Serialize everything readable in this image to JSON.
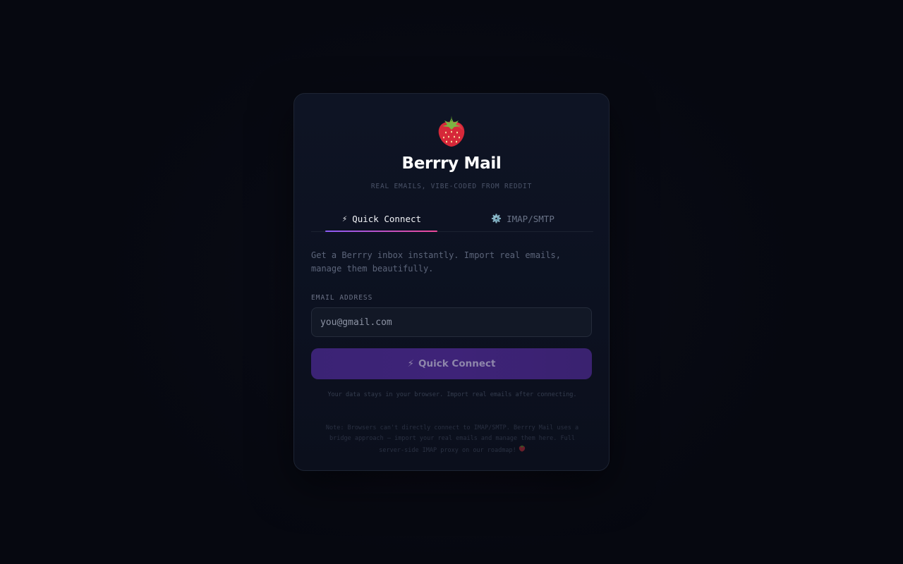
{
  "app": {
    "title": "Berrry Mail",
    "tagline": "REAL EMAILS, VIBE-CODED FROM REDDIT",
    "logo_icon": "strawberry-icon"
  },
  "tabs": [
    {
      "label": "Quick Connect",
      "icon": "lightning-icon",
      "glyph": "⚡",
      "active": true
    },
    {
      "label": "IMAP/SMTP",
      "icon": "gear-icon",
      "glyph": "⚙️",
      "active": false
    }
  ],
  "quick_connect": {
    "description": "Get a Berrry inbox instantly. Import real emails, manage them beautifully.",
    "email_label": "EMAIL ADDRESS",
    "email_value": "",
    "email_placeholder": "you@gmail.com",
    "button_label": "Quick Connect",
    "button_glyph": "⚡",
    "footnote": "Your data stays in your browser. Import real emails after connecting.",
    "note": "Note: Browsers can't directly connect to IMAP/SMTP. Berrry Mail uses a bridge approach — import your real emails and manage them here. Full server-side IMAP proxy on our roadmap!"
  },
  "colors": {
    "accent_start": "#8b5cf6",
    "accent_end": "#ec4899",
    "button_bg": "#3b2375",
    "card_bg": "#0e1424"
  }
}
